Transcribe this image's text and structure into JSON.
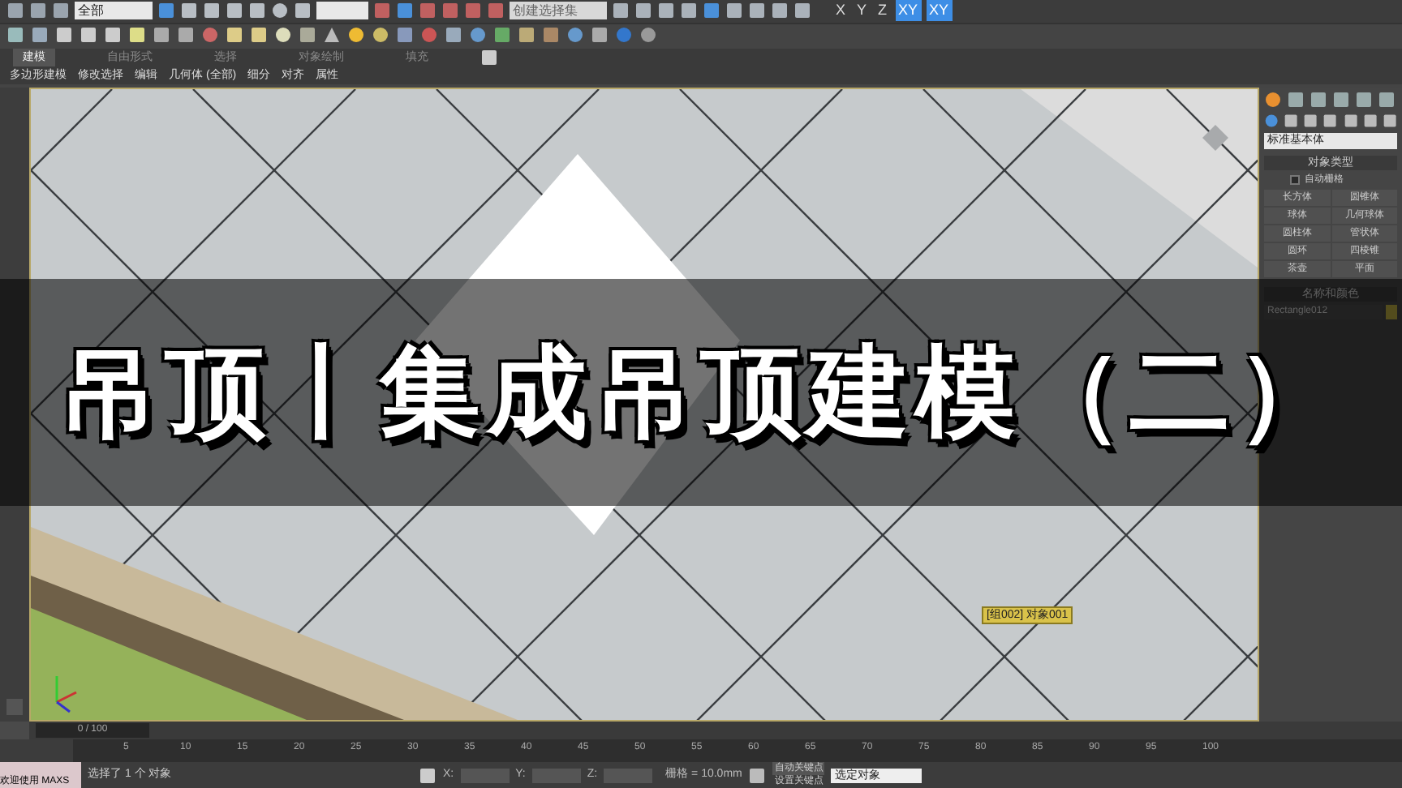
{
  "toolbar": {
    "selection_filter": "全部",
    "named_selection": "创建选择集",
    "axis_buttons": [
      {
        "label": "X",
        "selected": false
      },
      {
        "label": "Y",
        "selected": false
      },
      {
        "label": "Z",
        "selected": false
      },
      {
        "label": "XY",
        "selected": true
      },
      {
        "label": "XY",
        "selected": true
      }
    ]
  },
  "ribbon_tabs": [
    {
      "label": "建模",
      "selected": true
    },
    {
      "label": "自由形式",
      "selected": false
    },
    {
      "label": "选择",
      "selected": false
    },
    {
      "label": "对象绘制",
      "selected": false
    },
    {
      "label": "填充",
      "selected": false
    }
  ],
  "ribbon_panels": [
    "多边形建模",
    "修改选择",
    "编辑",
    "几何体 (全部)",
    "细分",
    "对齐",
    "属性"
  ],
  "viewport": {
    "object_label": "[组002] 对象001"
  },
  "overlay_title": "吊顶丨集成吊顶建模（二）",
  "command_panel": {
    "dropdown": "标准基本体",
    "object_type": {
      "title": "对象类型",
      "autogrid": {
        "label": "自动栅格",
        "checked": false
      },
      "buttons": [
        "长方体",
        "圆锥体",
        "球体",
        "几何球体",
        "圆柱体",
        "管状体",
        "圆环",
        "四棱锥",
        "茶壶",
        "平面"
      ]
    },
    "name_and_color": {
      "title": "名称和颜色",
      "name": "Rectangle012"
    }
  },
  "timeline": {
    "frame": "0 / 100",
    "ticks": [
      "5",
      "10",
      "15",
      "20",
      "25",
      "30",
      "35",
      "40",
      "45",
      "50",
      "55",
      "60",
      "65",
      "70",
      "75",
      "80",
      "85",
      "90",
      "95",
      "100"
    ]
  },
  "status": {
    "listener": "欢迎使用 MAXS",
    "message": "选择了 1 个 对象",
    "x_label": "X:",
    "y_label": "Y:",
    "z_label": "Z:",
    "grid": "栅格 = 10.0mm",
    "auto_key": "自动关键点",
    "key_dropdown": "选定对象",
    "set_key": "设置关键点"
  }
}
